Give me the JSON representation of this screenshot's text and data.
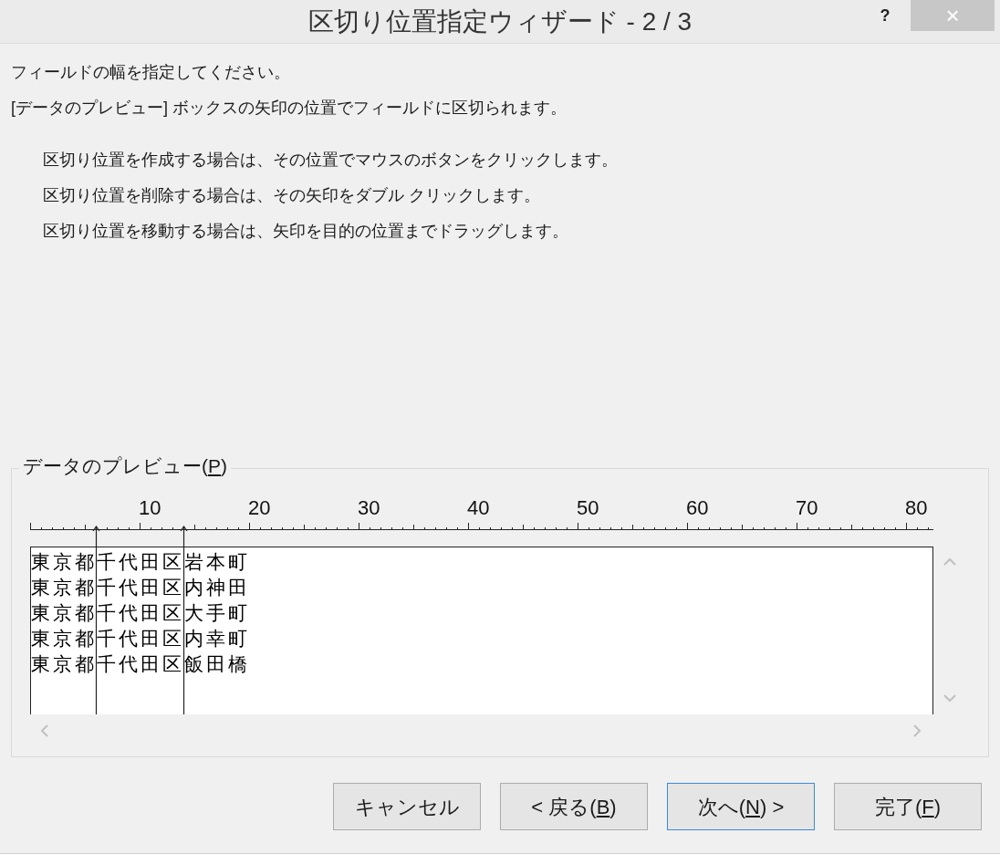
{
  "window": {
    "title": "区切り位置指定ウィザード - 2 / 3",
    "help": "?",
    "close": "×"
  },
  "intro": [
    "フィールドの幅を指定してください。",
    "[データのプレビュー] ボックスの矢印の位置でフィールドに区切られます。"
  ],
  "instructions": [
    "区切り位置を作成する場合は、その位置でマウスのボタンをクリックします。",
    "区切り位置を削除する場合は、その矢印をダブル クリックします。",
    "区切り位置を移動する場合は、矢印を目的の位置までドラッグします。"
  ],
  "preview": {
    "label_before": "データのプレビュー(",
    "access_key": "P",
    "label_after": ")",
    "ruler_labels": [
      "10",
      "20",
      "30",
      "40",
      "50",
      "60",
      "70",
      "80"
    ],
    "breaks": [
      {
        "level": 0.0727
      },
      {
        "level": 0.1697
      }
    ],
    "rows": [
      "東京都千代田区岩本町",
      "東京都千代田区内神田",
      "東京都千代田区大手町",
      "東京都千代田区内幸町",
      "東京都千代田区飯田橋"
    ]
  },
  "buttons": [
    {
      "before": "キャンセル",
      "default": false
    },
    {
      "before": "< 戻る(",
      "key": "B",
      "after": ")",
      "default": false
    },
    {
      "before": "次へ(",
      "key": "N",
      "after": ") >",
      "default": true
    },
    {
      "before": "完了(",
      "key": "F",
      "after": ")",
      "default": false
    }
  ]
}
